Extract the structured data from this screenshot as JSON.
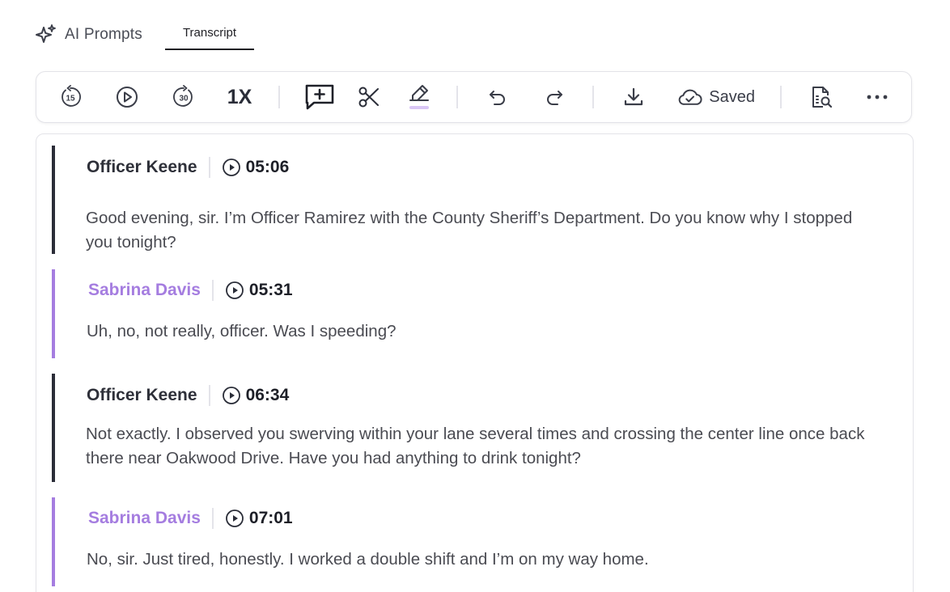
{
  "tabs": {
    "ai_prompts": "AI Prompts",
    "transcript": "Transcript"
  },
  "toolbar": {
    "skip_back_icon": "rewind-15-icon",
    "play_icon": "play-icon",
    "skip_forward_icon": "forward-30-icon",
    "skip_back_label": "15",
    "skip_forward_label": "30",
    "speed": "1X",
    "add_comment_icon": "add-comment-icon",
    "cut_icon": "scissors-icon",
    "highlight_icon": "highlighter-icon",
    "undo_icon": "undo-icon",
    "redo_icon": "redo-icon",
    "download_icon": "download-icon",
    "saved_label": "Saved",
    "search_doc_icon": "document-search-icon",
    "more_icon": "more-horizontal-icon"
  },
  "colors": {
    "officer_accent": "#2b2d38",
    "civilian_accent": "#a57de0",
    "highlight_accent": "#d9c6f5"
  },
  "transcript": [
    {
      "speaker": "Officer Keene",
      "timestamp": "05:06",
      "text": "Good evening, sir. I’m Officer Ramirez with the County Sheriff’s Department. Do you know why I stopped you tonight?"
    },
    {
      "speaker": "Sabrina Davis",
      "timestamp": "05:31",
      "text": "Uh, no, not really, officer. Was I speeding?"
    },
    {
      "speaker": "Officer Keene",
      "timestamp": "06:34",
      "text": "Not exactly. I observed you swerving within your lane several times and crossing the center line once back there near Oakwood Drive. Have you had anything to drink tonight?"
    },
    {
      "speaker": "Sabrina Davis",
      "timestamp": "07:01",
      "text": "No, sir. Just tired, honestly. I worked a double shift and I’m on my way home."
    }
  ]
}
